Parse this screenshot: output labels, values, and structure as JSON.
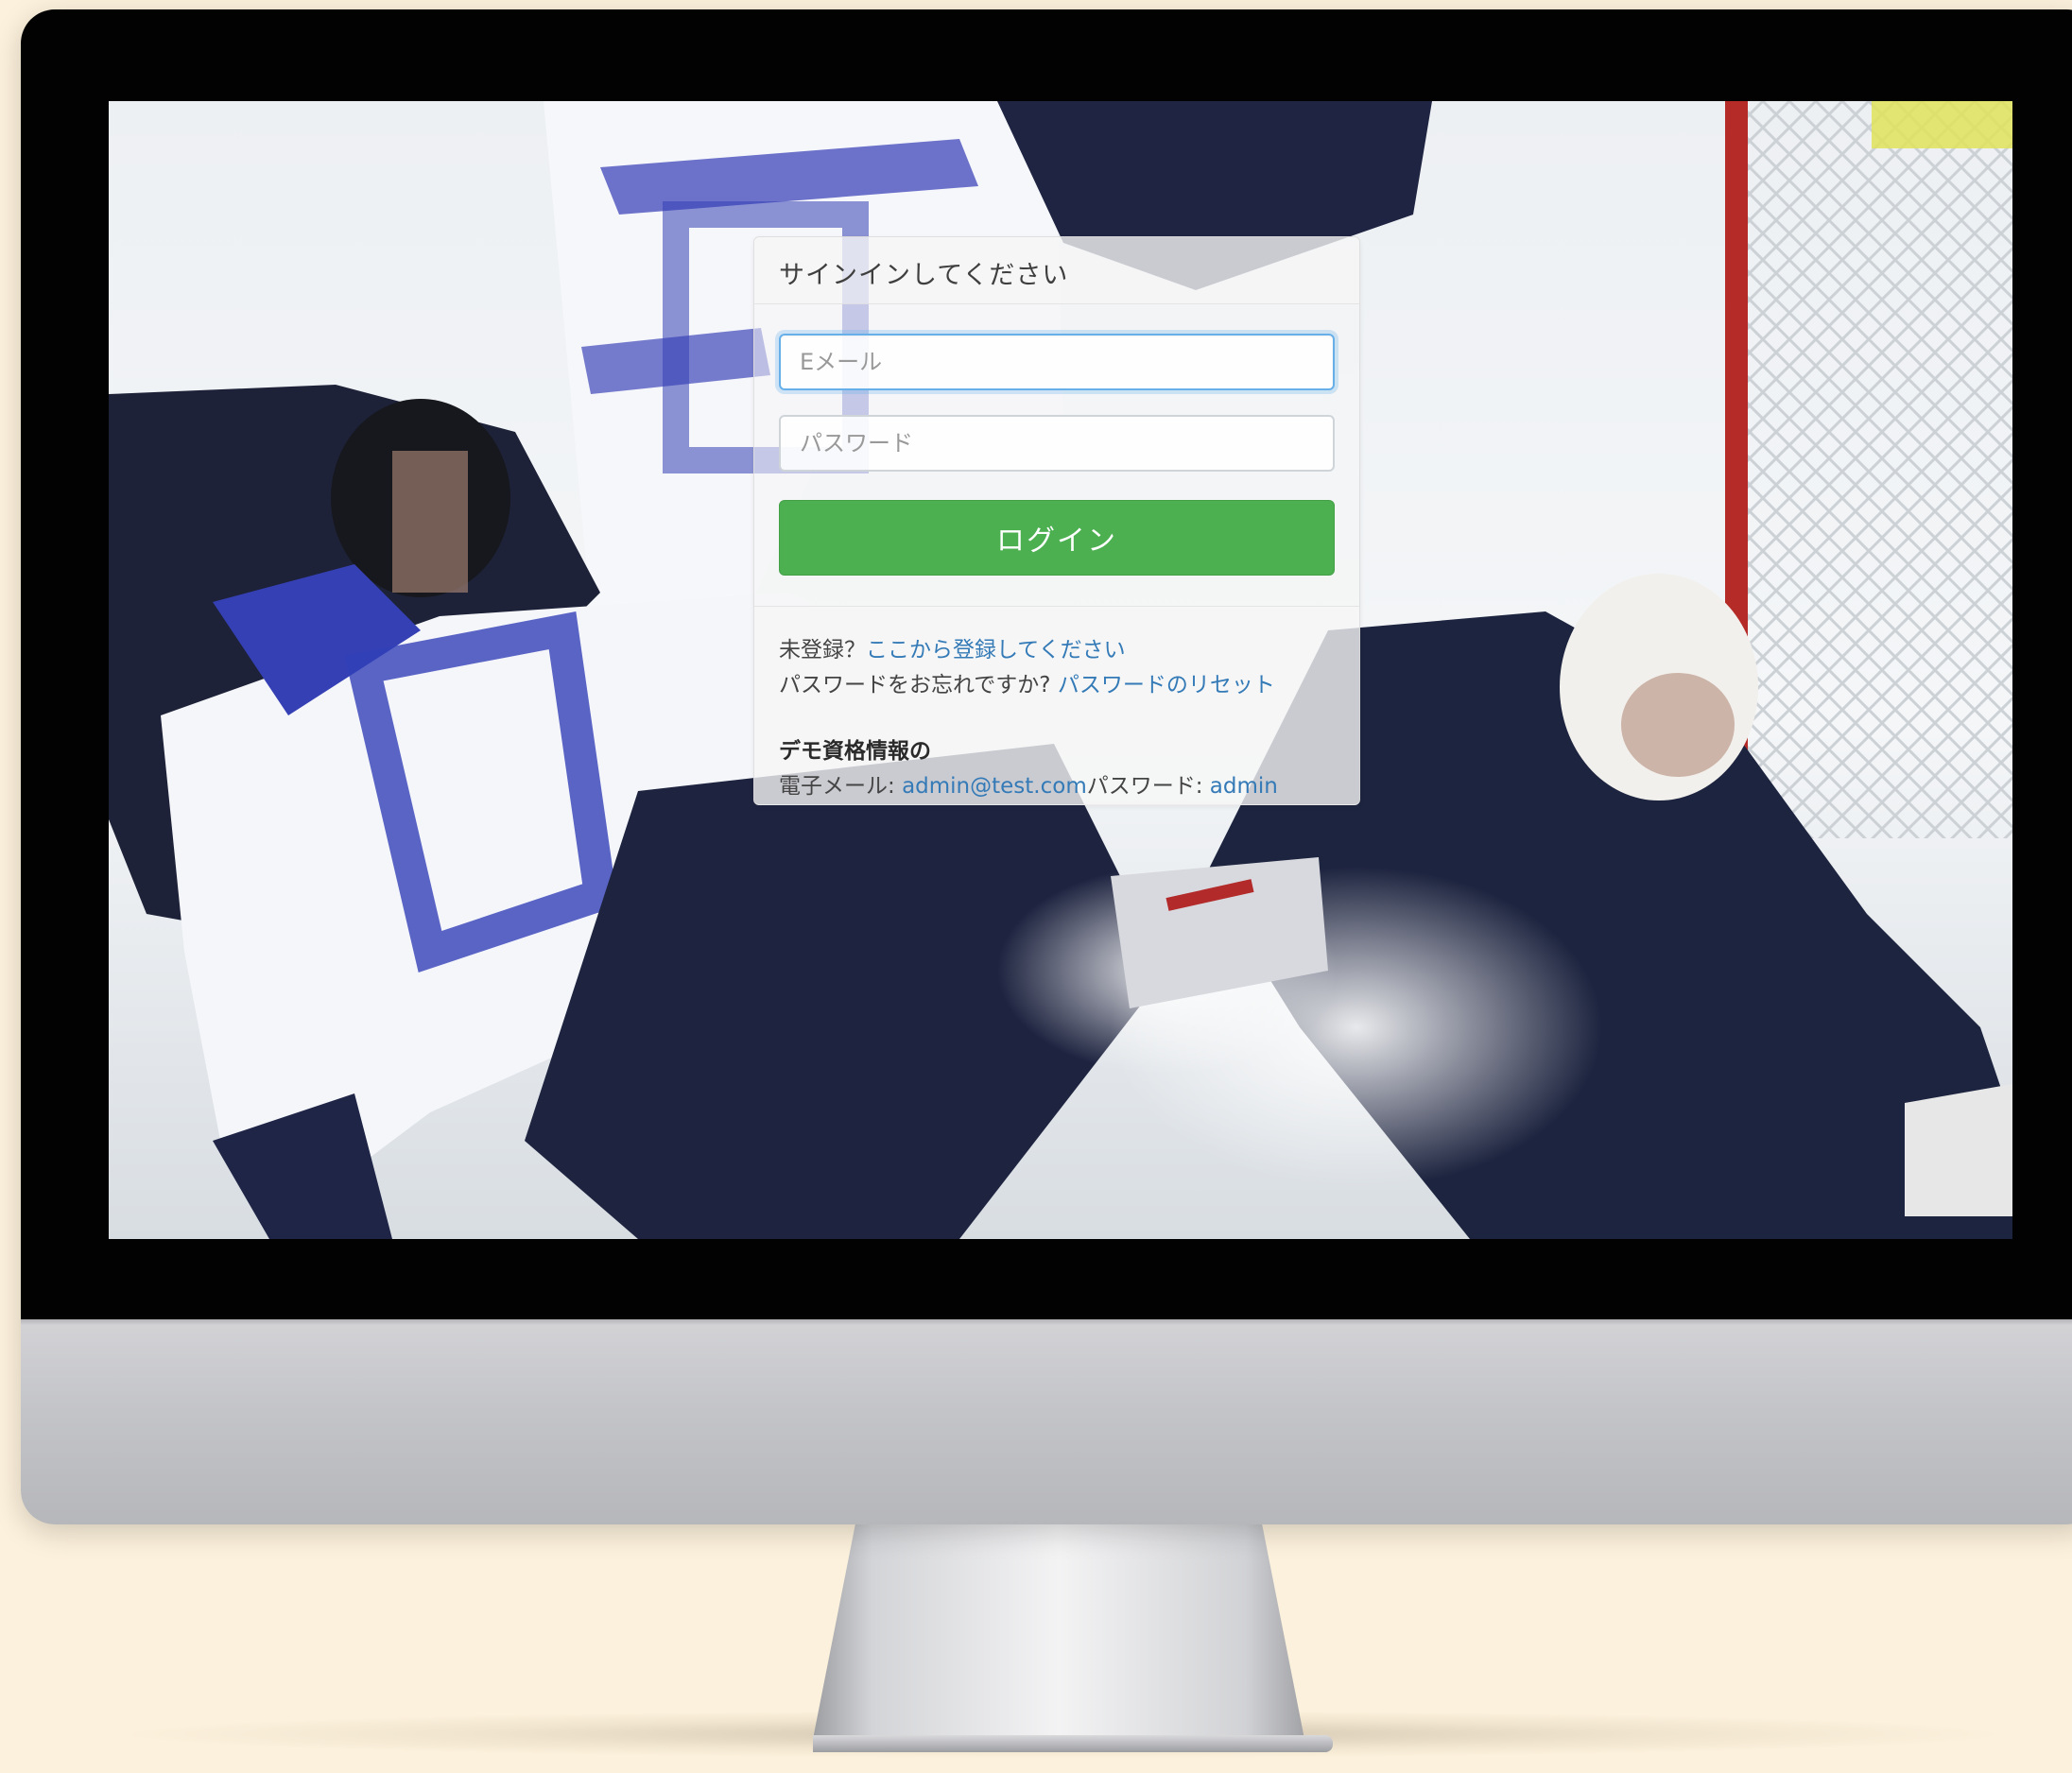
{
  "login": {
    "title": "サインインしてください",
    "email_placeholder": "Eメール",
    "password_placeholder": "パスワード",
    "login_button": "ログイン"
  },
  "links": {
    "signup_prompt": "未登録？",
    "signup_link": "ここから登録してください",
    "forgot_prompt": "パスワードをお忘れですか?",
    "reset_link": "パスワードのリセット"
  },
  "demo": {
    "heading": "デモ資格情報の",
    "email_label": "電子メール: ",
    "email_value": "admin@test.com",
    "password_label": "パスワード: ",
    "password_value": "admin"
  },
  "colors": {
    "page_background": "#fcf1dc",
    "bezel": "#020202",
    "login_button": "#4caf50",
    "link": "#337ab7",
    "focus_border": "#66afe9"
  },
  "icons": {
    "monitor": "imac-frame"
  }
}
